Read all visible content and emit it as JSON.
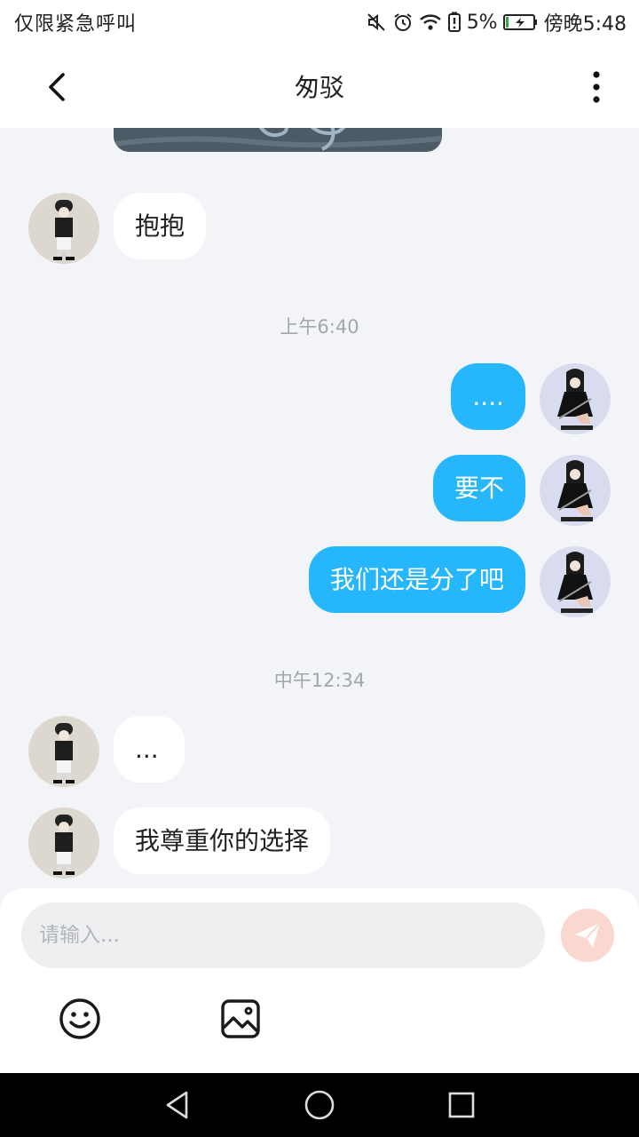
{
  "status_bar": {
    "left_text": "仅限紧急呼叫",
    "battery": "5%",
    "time": "傍晚5:48",
    "icons": [
      "mute-icon",
      "alarm-icon",
      "wifi-icon",
      "battery-alert-icon",
      "battery-charging-icon"
    ]
  },
  "header": {
    "title": "匆驳",
    "back_icon": "chevron-left-icon",
    "more_icon": "more-vertical-icon"
  },
  "timestamps": [
    "上午6:40",
    "中午12:34"
  ],
  "messages": [
    {
      "sender": "partner",
      "text": "抱抱"
    },
    {
      "sender": "me",
      "text": "...."
    },
    {
      "sender": "me",
      "text": "要不"
    },
    {
      "sender": "me",
      "text": "我们还是分了吧"
    },
    {
      "sender": "partner",
      "text": "..."
    },
    {
      "sender": "partner",
      "text": "我尊重你的选择"
    }
  ],
  "composer": {
    "placeholder": "请输入...",
    "value": "",
    "send_icon": "paper-plane-icon",
    "emoji_icon": "smiley-icon",
    "image_icon": "image-icon"
  },
  "colors": {
    "outgoing_bubble": "#26b6fb",
    "incoming_bubble": "#ffffff",
    "chat_background": "#f3f4f7",
    "send_button": "#fbd8cf"
  }
}
